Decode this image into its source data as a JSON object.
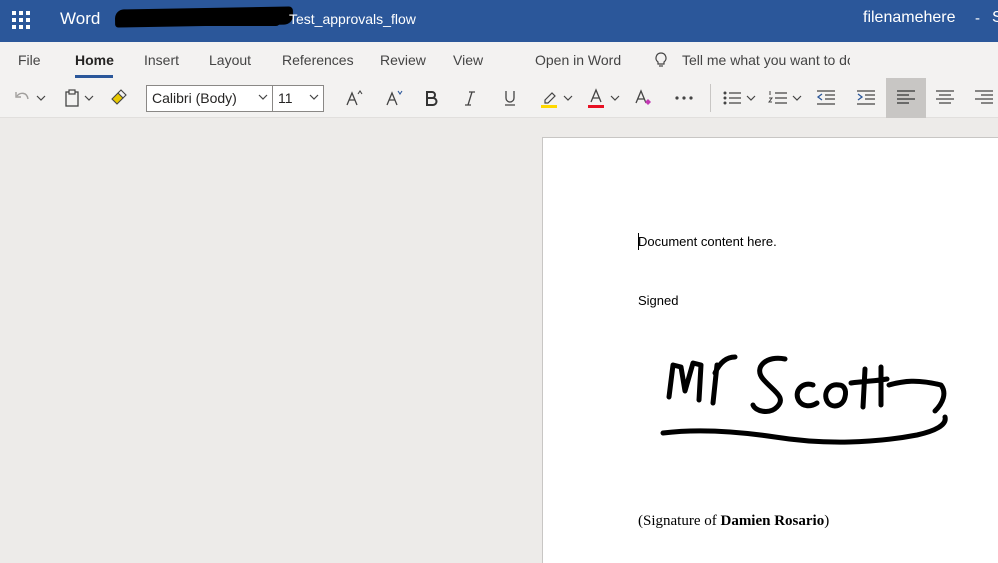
{
  "titlebar": {
    "app_name": "Word",
    "doc_title": "Test_approvals_flow",
    "filename": "filenamehere",
    "separator": "-",
    "cut_char": "S"
  },
  "tabs": [
    "File",
    "Home",
    "Insert",
    "Layout",
    "References",
    "Review",
    "View",
    "Open in Word"
  ],
  "active_tab": "Home",
  "tell_me": "Tell me what you want to do",
  "toolbar": {
    "font_name": "Calibri (Body)",
    "font_size": "11",
    "highlight_color": "#ffd800",
    "font_color": "#e81123"
  },
  "document": {
    "line1": "Document content here.",
    "signed_label": "Signed",
    "signature_prefix": "(Signature of ",
    "signer_name": "Damien Rosario",
    "signature_suffix": ")",
    "signature_image_text": "Mr Scott"
  },
  "colors": {
    "brand": "#2b579a",
    "ribbon": "#f3f2f1",
    "canvas": "#edebe9"
  }
}
